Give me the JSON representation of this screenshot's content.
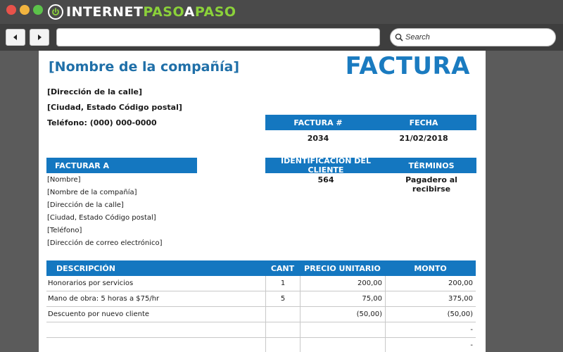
{
  "window": {
    "site_name_part1": "INTERNET",
    "site_name_part2": "PASO",
    "site_name_part3": "A",
    "site_name_part4": "PASO",
    "search_label": "Search"
  },
  "invoice": {
    "company_name": "[Nombre de la compañía]",
    "title": "FACTURA",
    "street": "[Dirección de la calle]",
    "city": "[Ciudad, Estado Código postal]",
    "phone": "Teléfono: (000) 000-0000",
    "invoice_no_label": "FACTURA #",
    "date_label": "FECHA",
    "invoice_no": "2034",
    "date": "21/02/2018",
    "bill_to_label": "FACTURAR A",
    "customer_id_label": "IDENTIFICACIÓN DEL CLIENTE",
    "terms_label": "TÉRMINOS",
    "customer_id": "564",
    "terms": "Pagadero al recibirse",
    "bill_to_lines": [
      "[Nombre]",
      "[Nombre de la compañía]",
      "[Dirección de la calle]",
      "[Ciudad, Estado Código postal]",
      "[Teléfono]",
      "[Dirección de correo electrónico]"
    ],
    "table": {
      "headers": {
        "description": "DESCRIPCIÓN",
        "qty": "CANT",
        "unit_price": "PRECIO UNITARIO",
        "amount": "MONTO"
      },
      "rows": [
        {
          "description": "Honorarios por servicios",
          "qty": "1",
          "unit_price": "200,00",
          "amount": "200,00"
        },
        {
          "description": "Mano de obra: 5 horas a $75/hr",
          "qty": "5",
          "unit_price": "75,00",
          "amount": "375,00"
        },
        {
          "description": "Descuento por nuevo cliente",
          "qty": "",
          "unit_price": "(50,00)",
          "amount": "(50,00)"
        },
        {
          "description": "",
          "qty": "",
          "unit_price": "",
          "amount": "-"
        },
        {
          "description": "",
          "qty": "",
          "unit_price": "",
          "amount": "-"
        }
      ]
    }
  }
}
